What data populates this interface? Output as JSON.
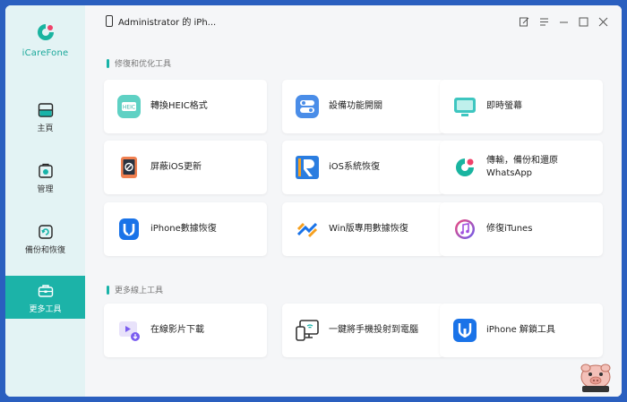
{
  "app": {
    "name": "iCareFone"
  },
  "device": {
    "name": "Administrator 的 iPh..."
  },
  "sidebar": {
    "items": [
      {
        "label": "主頁",
        "icon": "home-icon"
      },
      {
        "label": "管理",
        "icon": "manage-icon"
      },
      {
        "label": "備份和恢復",
        "icon": "backup-icon"
      },
      {
        "label": "更多工具",
        "icon": "toolbox-icon",
        "active": true
      }
    ]
  },
  "sections": {
    "repair": {
      "title": "修復和优化工具"
    },
    "more": {
      "title": "更多線上工具"
    }
  },
  "cards": [
    {
      "label": "轉換HEIC格式",
      "icon": "heic-icon"
    },
    {
      "label": "設備功能開關",
      "icon": "toggle-icon"
    },
    {
      "label": "即時螢幕",
      "icon": "screen-icon"
    },
    {
      "label": "屏蔽iOS更新",
      "icon": "block-update-icon"
    },
    {
      "label": "iOS系統恢復",
      "icon": "reiboot-icon"
    },
    {
      "label": "傳輸，備份和還原 WhatsApp",
      "icon": "whatsapp-transfer-icon"
    },
    {
      "label": "iPhone數據恢復",
      "icon": "ultdata-icon"
    },
    {
      "label": "Win版專用數據恢復",
      "icon": "win-recovery-icon"
    },
    {
      "label": "修復iTunes",
      "icon": "itunes-icon"
    },
    {
      "label": "在線影片下載",
      "icon": "video-download-icon"
    },
    {
      "label": "一鍵將手機投射到電腦",
      "icon": "phone-mirror-icon"
    },
    {
      "label": "iPhone 解鎖工具",
      "icon": "unlock-icon"
    }
  ],
  "colors": {
    "accent": "#1cb3a8",
    "sidebar_bg": "#e3f3f4",
    "window_bg": "#f5f6f8"
  }
}
